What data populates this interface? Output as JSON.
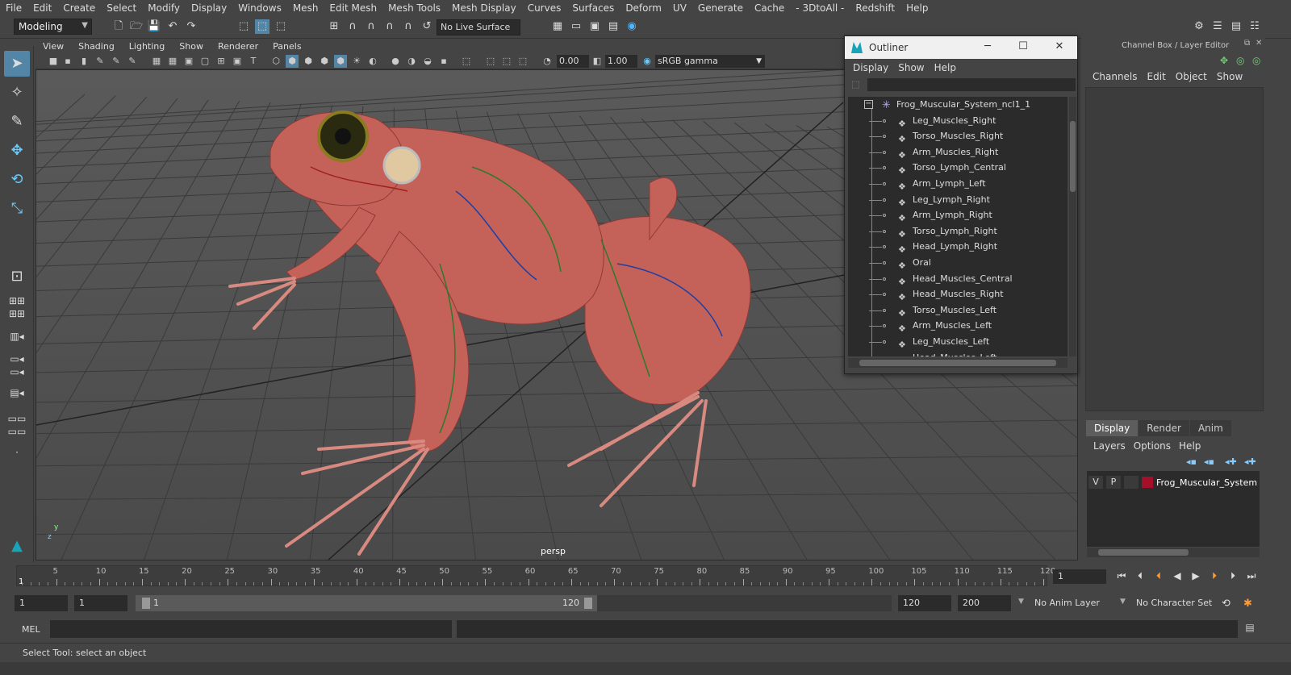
{
  "menubar": [
    "File",
    "Edit",
    "Create",
    "Select",
    "Modify",
    "Display",
    "Windows",
    "Mesh",
    "Edit Mesh",
    "Mesh Tools",
    "Mesh Display",
    "Curves",
    "Surfaces",
    "Deform",
    "UV",
    "Generate",
    "Cache",
    "- 3DtoAll -",
    "Redshift",
    "Help"
  ],
  "shelf": {
    "mode": "Modeling",
    "live_surface": "No Live Surface"
  },
  "viewport": {
    "menu": [
      "View",
      "Shading",
      "Lighting",
      "Show",
      "Renderer",
      "Panels"
    ],
    "exposure": "0.00",
    "gamma": "1.00",
    "color_space": "sRGB gamma",
    "camera_label": "persp",
    "axis_labels": [
      "y",
      "z"
    ]
  },
  "outliner": {
    "title": "Outliner",
    "menu": [
      "Display",
      "Show",
      "Help"
    ],
    "root": "Frog_Muscular_System_ncl1_1",
    "items": [
      "Leg_Muscles_Right",
      "Torso_Muscles_Right",
      "Arm_Muscles_Right",
      "Torso_Lymph_Central",
      "Arm_Lymph_Left",
      "Leg_Lymph_Right",
      "Arm_Lymph_Right",
      "Torso_Lymph_Right",
      "Head_Lymph_Right",
      "Oral",
      "Head_Muscles_Central",
      "Head_Muscles_Right",
      "Torso_Muscles_Left",
      "Arm_Muscles_Left",
      "Leg_Muscles_Left",
      "Head_Muscles_Left"
    ]
  },
  "channelbox": {
    "title": "Channel Box / Layer Editor",
    "menu": [
      "Channels",
      "Edit",
      "Object",
      "Show"
    ]
  },
  "layer_editor": {
    "tabs": [
      "Display",
      "Render",
      "Anim"
    ],
    "menu": [
      "Layers",
      "Options",
      "Help"
    ],
    "layer": {
      "v": "V",
      "p": "P",
      "name": "Frog_Muscular_System",
      "color": "#a4102a"
    }
  },
  "timeline": {
    "labels": [
      "5",
      "10",
      "15",
      "20",
      "25",
      "30",
      "35",
      "40",
      "45",
      "50",
      "55",
      "60",
      "65",
      "70",
      "75",
      "80",
      "85",
      "90",
      "95",
      "100",
      "105",
      "110",
      "115",
      "120"
    ],
    "current_marker": "1",
    "current_frame": "1"
  },
  "range": {
    "start": "1",
    "inner_start": "1",
    "slider_start": "1",
    "slider_end": "120",
    "end": "120",
    "outer_end": "200",
    "anim_layer": "No Anim Layer",
    "char_set": "No Character Set"
  },
  "cmdline": {
    "label": "MEL"
  },
  "helpline": {
    "text": "Select Tool: select an object"
  }
}
